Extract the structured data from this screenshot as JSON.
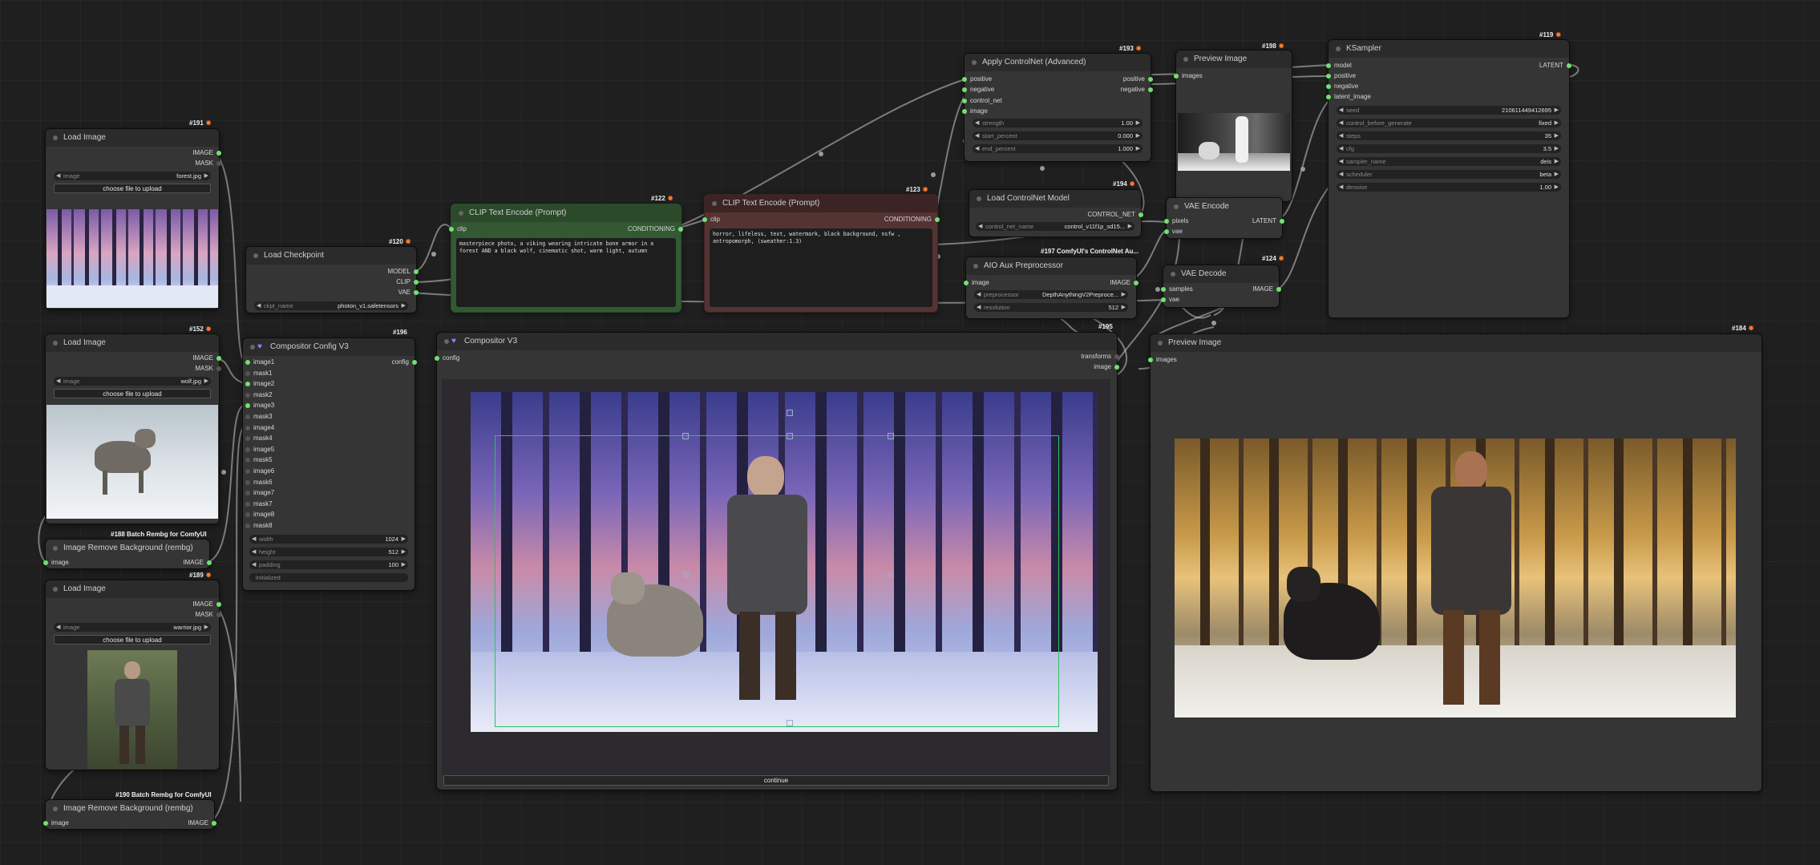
{
  "nodes": {
    "load_image_191": {
      "title": "Load Image",
      "id": "#191",
      "out_image": "IMAGE",
      "out_mask": "MASK",
      "w_image_label": "image",
      "w_image_value": "forest.jpg",
      "upload": "choose file to upload"
    },
    "load_image_152": {
      "title": "Load Image",
      "id": "#152",
      "out_image": "IMAGE",
      "out_mask": "MASK",
      "w_image_label": "image",
      "w_image_value": "wolf.jpg",
      "upload": "choose file to upload"
    },
    "rembg_188": {
      "title": "Image Remove Background (rembg)",
      "tag": "#188 Batch Rembg for ComfyUI",
      "in_image": "image",
      "out_image": "IMAGE"
    },
    "load_image_189": {
      "title": "Load Image",
      "id": "#189",
      "out_image": "IMAGE",
      "out_mask": "MASK",
      "w_image_label": "image",
      "w_image_value": "warrior.jpg",
      "upload": "choose file to upload"
    },
    "rembg_190": {
      "title": "Image Remove Background (rembg)",
      "tag": "#190 Batch Rembg for ComfyUI",
      "in_image": "image",
      "out_image": "IMAGE"
    },
    "load_checkpoint_120": {
      "title": "Load Checkpoint",
      "id": "#120",
      "out_model": "MODEL",
      "out_clip": "CLIP",
      "out_vae": "VAE",
      "w_ckpt_label": "ckpt_name",
      "w_ckpt_value": "photon_v1.safetensors"
    },
    "clip_pos_122": {
      "title": "CLIP Text Encode (Prompt)",
      "id": "#122",
      "in_clip": "clip",
      "out_cond": "CONDITIONING",
      "text": "masterpiece photo, a viking wearing intricate bone armor in a forest AND a black wolf, cinematic shot, warm light, autumn"
    },
    "clip_neg_123": {
      "title": "CLIP Text Encode (Prompt)",
      "id": "#123",
      "in_clip": "clip",
      "out_cond": "CONDITIONING",
      "text": "horror, lifeless, text, watermark, black background, nsfw , antropomorph, (sweather:1.3)"
    },
    "controlnet_193": {
      "title": "Apply ControlNet (Advanced)",
      "id": "#193",
      "in_positive": "positive",
      "in_negative": "negative",
      "in_control_net": "control_net",
      "in_image": "image",
      "out_positive": "positive",
      "out_negative": "negative",
      "w_strength_label": "strength",
      "w_strength_value": "1.00",
      "w_start_label": "start_percent",
      "w_start_value": "0.000",
      "w_end_label": "end_percent",
      "w_end_value": "1.000"
    },
    "load_controlnet_194": {
      "title": "Load ControlNet Model",
      "id": "#194",
      "out_cn": "CONTROL_NET",
      "w_cn_label": "control_net_name",
      "w_cn_value": "control_v11f1p_sd15..."
    },
    "aio_197": {
      "title": "AIO Aux Preprocessor",
      "tag": "#197 ComfyUI's ControlNet Au...",
      "in_image": "image",
      "out_image": "IMAGE",
      "w_pre_label": "preprocessor",
      "w_pre_value": "DepthAnythingV2Preproce...",
      "w_res_label": "resolution",
      "w_res_value": "512"
    },
    "preview_198": {
      "title": "Preview Image",
      "id": "#198",
      "in_images": "images"
    },
    "vae_encode": {
      "title": "VAE Encode",
      "in_pixels": "pixels",
      "in_vae": "vae",
      "out_latent": "LATENT"
    },
    "vae_decode_124": {
      "title": "VAE Decode",
      "id": "#124",
      "in_samples": "samples",
      "in_vae": "vae",
      "out_image": "IMAGE"
    },
    "ksampler_119": {
      "title": "KSampler",
      "id": "#119",
      "in_model": "model",
      "in_positive": "positive",
      "in_negative": "negative",
      "in_latent": "latent_image",
      "out_latent": "LATENT",
      "w_seed_label": "seed",
      "w_seed_value": "210611449412695",
      "w_cbg_label": "control_before_generate",
      "w_cbg_value": "fixed",
      "w_steps_label": "steps",
      "w_steps_value": "35",
      "w_cfg_label": "cfg",
      "w_cfg_value": "3.5",
      "w_sampler_label": "sampler_name",
      "w_sampler_value": "deis",
      "w_sched_label": "scheduler",
      "w_sched_value": "beta",
      "w_denoise_label": "denoise",
      "w_denoise_value": "1.00"
    },
    "compositor_config_196": {
      "title": "Compositor Config V3",
      "id": "#196",
      "out_config": "config",
      "inputs": [
        "image1",
        "mask1",
        "image2",
        "mask2",
        "image3",
        "mask3",
        "image4",
        "mask4",
        "image5",
        "mask5",
        "image6",
        "mask6",
        "image7",
        "mask7",
        "image8",
        "mask8"
      ],
      "w_width_label": "width",
      "w_width_value": "1024",
      "w_height_label": "height",
      "w_height_value": "512",
      "w_padding_label": "padding",
      "w_padding_value": "100",
      "w_init": "initialized"
    },
    "compositor_195": {
      "title": "Compositor V3",
      "id": "#195",
      "in_config": "config",
      "out_transforms": "transforms",
      "out_image": "image",
      "continue": "continue"
    },
    "preview_184": {
      "title": "Preview Image",
      "id": "#184",
      "in_images": "images"
    }
  },
  "colors": {
    "link_green": "#6fe36f",
    "positive_node": "#335933",
    "negative_node": "#553333",
    "accent_fox": "#ff7a2e",
    "selection": "#30c060"
  },
  "icons": [
    "fox-icon",
    "heart-icon",
    "collapse-dot-icon",
    "arrow-left-icon",
    "arrow-right-icon"
  ]
}
